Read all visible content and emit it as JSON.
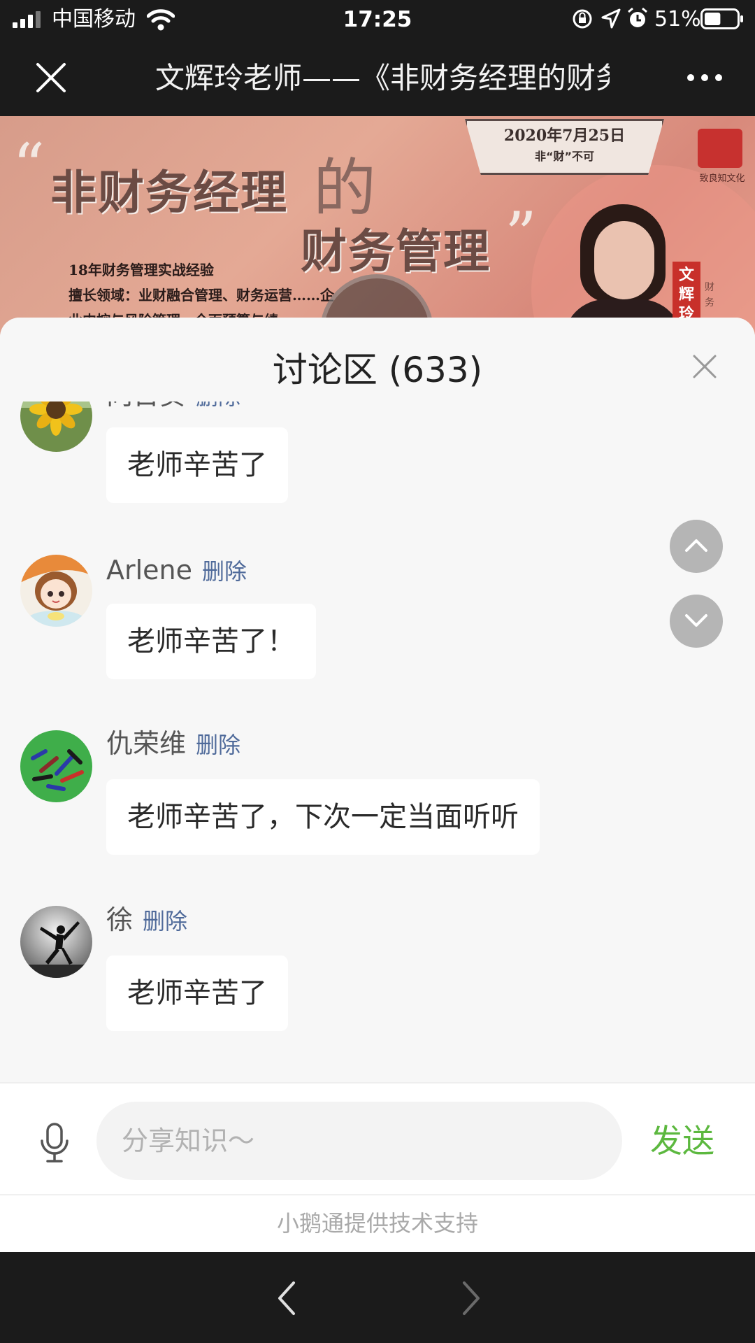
{
  "status_bar": {
    "carrier": "中国移动",
    "time": "17:25",
    "battery": "51%",
    "battery_level": 0.51,
    "icons": [
      "signal-icon",
      "wifi-icon",
      "orientation-lock-icon",
      "location-icon",
      "alarm-icon",
      "battery-icon"
    ]
  },
  "title_bar": {
    "title": "文辉玲老师——《非财务经理的财务管理》",
    "icons": [
      "close-icon",
      "more-icon"
    ]
  },
  "banner": {
    "date": "2020年7月25日",
    "slogan": "非“财”不可",
    "seal_text": "致良知文化",
    "headline_part1": "非财务经理",
    "headline_part2": "的",
    "headline_part3": "财务管理",
    "quote_open": "“",
    "quote_close": "”",
    "line1": "18年财务管理实战经验",
    "line2": "擅长领域：业财融合管理、财务运营……企",
    "line3": "业内控与风险管理、全面预算与绩……",
    "name": "文辉玲",
    "side_text": "财务"
  },
  "discussion": {
    "title": "讨论区 (633)",
    "delete_label": "删除",
    "comments": [
      {
        "name": "向日葵",
        "text": "老师辛苦了",
        "avatar": "sunflower"
      },
      {
        "name": "Arlene",
        "text": "老师辛苦了！",
        "avatar": "cartoon-girl"
      },
      {
        "name": "仇荣维",
        "text": "老师辛苦了，下次一定当面听听",
        "avatar": "group-photo"
      },
      {
        "name": "徐",
        "text": "老师辛苦了",
        "avatar": "silhouette"
      }
    ]
  },
  "composer": {
    "placeholder": "分享知识～",
    "value": "",
    "send_label": "发送"
  },
  "footer": {
    "powered_by": "小鹅通提供技术支持"
  },
  "colors": {
    "accent_green": "#5cb83f",
    "delete_blue": "#4f6a9a",
    "dark_bar": "#1b1b1b",
    "sheet_bg": "#f7f7f7"
  }
}
